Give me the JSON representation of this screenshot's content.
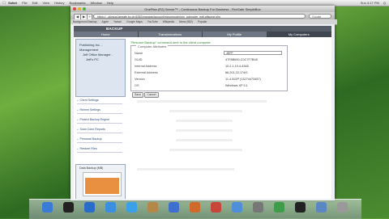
{
  "menubar": {
    "apple": "",
    "items": [
      "Safari",
      "File",
      "Edit",
      "View",
      "History",
      "Bookmarks",
      "Window",
      "Help"
    ],
    "right": [
      "Sun 4:17 PM",
      "Q"
    ]
  },
  "window": {
    "title": "OnePlan (R2) Server™ - Continuous Backup For Business - FireGate SimpleBox",
    "url": "https://...stivaus.fangate.bc.ch:8280/manage/account/mycomputer/my_computer_edit.aftsome.php",
    "search_placeholder": "Google",
    "back": "◀",
    "forward": "▶",
    "bookmarks": [
      "Background Backup",
      "Apple",
      "Yahoo!",
      "Google Maps",
      "YouTube",
      "Wikipedia",
      "News (982)",
      "Popular"
    ]
  },
  "site": {
    "logo": "BACKUP",
    "tabs": [
      "Home",
      "Transformations",
      "My Profile",
      "My Computers"
    ],
    "active_tab": 3,
    "org": [
      "Publishing Inc. -",
      "Management",
      "Jeff Office Manager -",
      "Jeff's PC"
    ],
    "nav": [
      "Client Settings",
      "Reimm Settings",
      "Protect Backup Engine",
      "Scan Conn Reports",
      "Personal Backup",
      "Restore Files"
    ],
    "chart_label": "Data Backup (MB)"
  },
  "main": {
    "message": "\"Resume Backup\" command sent to the client computer",
    "legend": "Computer Attributes",
    "fields": [
      {
        "label": "Name",
        "value": "JEFF"
      },
      {
        "label": "GUID",
        "value": "47F8B000-C0C7F7B48"
      },
      {
        "label": "Internal Address",
        "value": "10.2.1.10.4-4345"
      },
      {
        "label": "External Address",
        "value": "66.201.22.174/0"
      },
      {
        "label": "Version",
        "value": "11.4.002P (13274473457)"
      },
      {
        "label": "OS",
        "value": "Windows XP 5.1"
      }
    ],
    "save": "Save",
    "cancel": "Cancel"
  },
  "dock": {
    "items": [
      "finder-icon",
      "dashboard-icon",
      "mail-icon",
      "safari-icon",
      "ichat-icon",
      "address-book-icon",
      "itunes-icon",
      "photo-icon",
      "ical-icon",
      "preview-icon",
      "system-preferences-icon",
      "time-machine-icon",
      "terminal-icon",
      "folder-icon",
      "trash-icon"
    ],
    "colors": [
      "#3a7bd5",
      "#222",
      "#2a6cc9",
      "#3b8fe0",
      "#3aa0e8",
      "#b38748",
      "#3e6fd0",
      "#d06a2b",
      "#c8453a",
      "#4f8ed8",
      "#777",
      "#3f9c4a",
      "#222",
      "#5b86c4",
      "#999"
    ]
  }
}
